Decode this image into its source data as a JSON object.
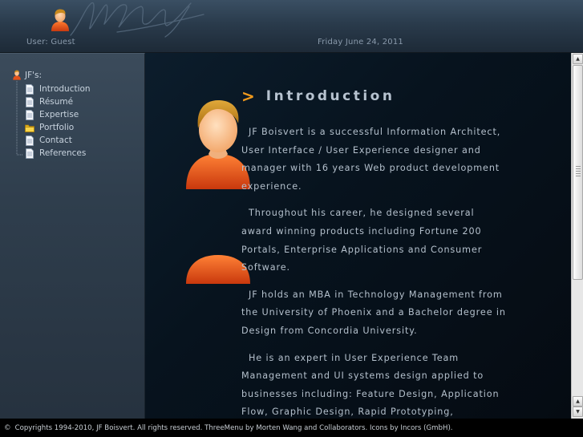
{
  "header": {
    "user_label": "User: Guest",
    "date_label": "Friday June 24, 2011"
  },
  "sidebar": {
    "root_label": "JF's:",
    "items": [
      {
        "label": "Introduction",
        "icon": "document-icon"
      },
      {
        "label": "Résumé",
        "icon": "document-icon"
      },
      {
        "label": "Expertise",
        "icon": "document-icon"
      },
      {
        "label": "Portfolio",
        "icon": "folder-icon"
      },
      {
        "label": "Contact",
        "icon": "document-icon"
      },
      {
        "label": "References",
        "icon": "document-icon"
      }
    ]
  },
  "main": {
    "title_arrow": ">",
    "title": "Introduction",
    "paragraphs": [
      "JF Boisvert is a successful Information Architect, User Interface / User Experience designer and manager with 16 years Web product development experience.",
      "Throughout his career, he designed several award winning products including Fortune 200 Portals, Enterprise Applications and Consumer Software.",
      "JF holds an MBA in Technology Management from the University of Phoenix and a Bachelor degree in Design from Concordia University.",
      "He is an expert in User Experience Team Management and UI systems design applied to businesses including: Feature Design, Application Flow, Graphic Design, Rapid Prototyping, Wireframing, Usability Testing, Project, Resources"
    ]
  },
  "footer": {
    "copyright_symbol": "©",
    "text": "Copyrights 1994-2010, JF Boisvert. All rights reserved. ThreeMenu by Morten Wang and Collaborators. Icons by Incors (GmbH)."
  },
  "colors": {
    "accent_orange": "#f39a1c",
    "body_text": "#b4c0cc",
    "sidebar_bg": "#2f3e4d",
    "main_bg": "#07131e"
  }
}
